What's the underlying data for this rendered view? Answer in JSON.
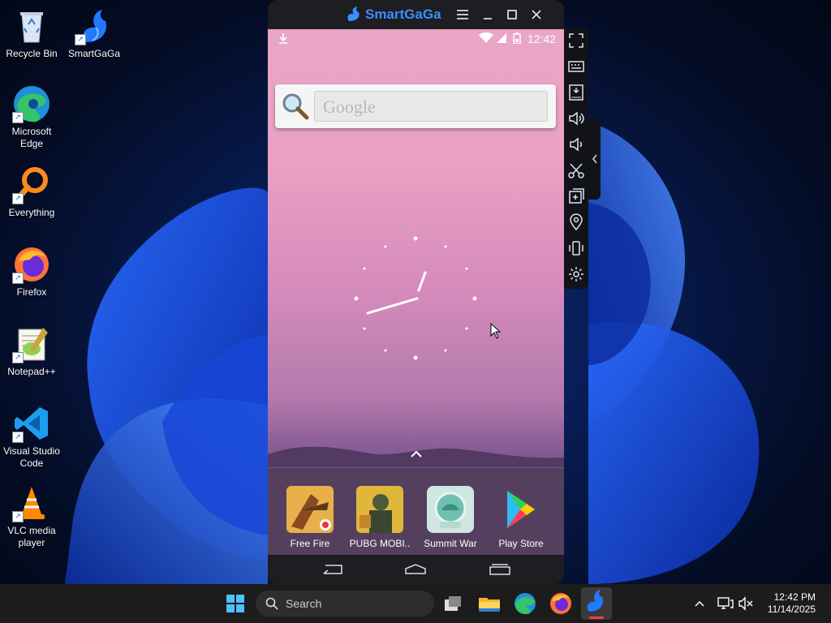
{
  "desktop": {
    "icons": [
      {
        "label": "Recycle Bin"
      },
      {
        "label": "SmartGaGa"
      },
      {
        "label": "Microsoft Edge"
      },
      {
        "label": "Everything"
      },
      {
        "label": "Firefox"
      },
      {
        "label": "Notepad++"
      },
      {
        "label": "Visual Studio Code"
      },
      {
        "label": "VLC media player"
      }
    ]
  },
  "emulator": {
    "title": "SmartGaGa",
    "status": {
      "time": "12:42"
    },
    "search_placeholder": "Google",
    "dock_apps": [
      {
        "label": "Free Fire"
      },
      {
        "label": "PUBG MOBI.."
      },
      {
        "label": "Summit War"
      },
      {
        "label": "Play Store"
      }
    ]
  },
  "taskbar": {
    "search_label": "Search",
    "time": "12:42 PM",
    "date": "11/14/2025"
  },
  "colors": {
    "accent": "#3b8fff",
    "taskbar": "#1c1c1c",
    "active_app": "#e8454b"
  }
}
